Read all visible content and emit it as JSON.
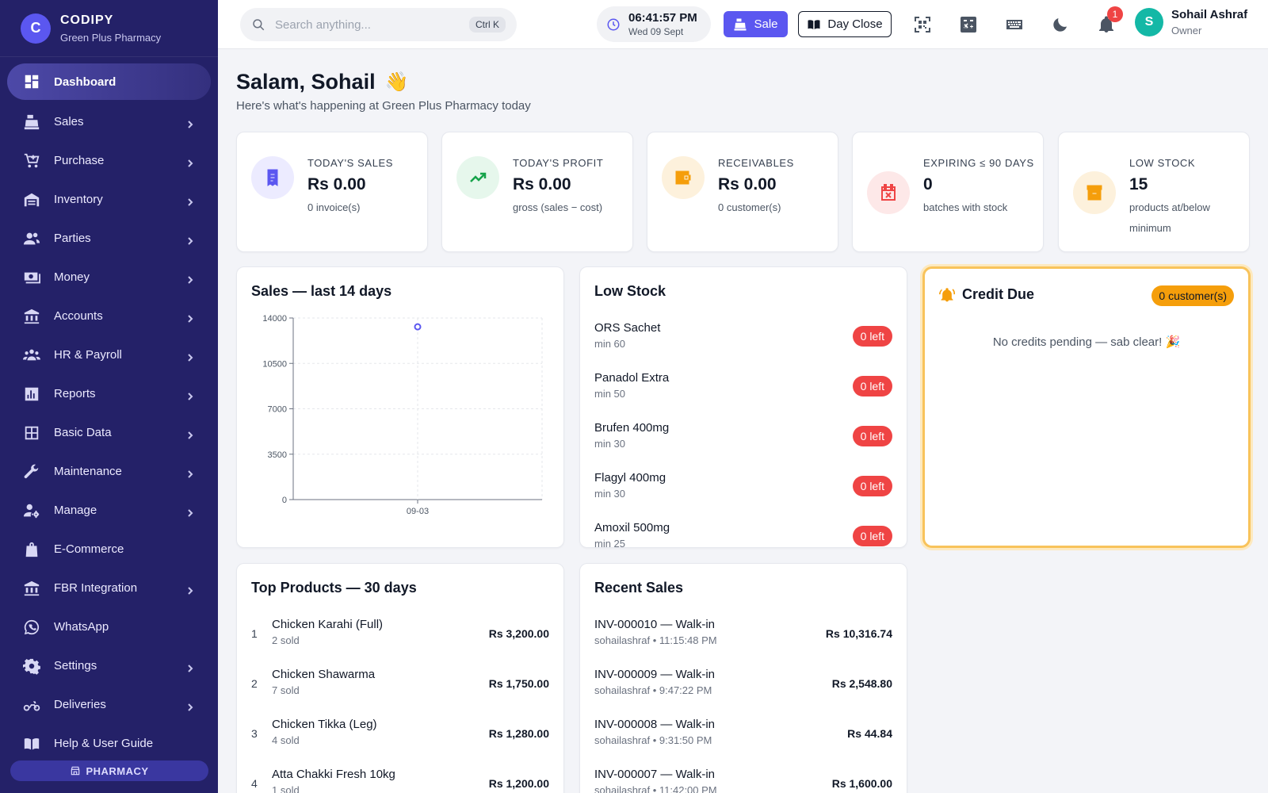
{
  "brand": {
    "logo_letter": "C",
    "name": "CODIPY",
    "subtitle": "Green Plus Pharmacy"
  },
  "sidebar": {
    "items": [
      {
        "label": "Dashboard",
        "icon": "dashboard-icon",
        "active": true,
        "has_chevron": false
      },
      {
        "label": "Sales",
        "icon": "cash-register-icon",
        "has_chevron": true
      },
      {
        "label": "Purchase",
        "icon": "cart-icon",
        "has_chevron": true
      },
      {
        "label": "Inventory",
        "icon": "warehouse-icon",
        "has_chevron": true
      },
      {
        "label": "Parties",
        "icon": "people-icon",
        "has_chevron": true
      },
      {
        "label": "Money",
        "icon": "money-icon",
        "has_chevron": true
      },
      {
        "label": "Accounts",
        "icon": "bank-icon",
        "has_chevron": true
      },
      {
        "label": "HR & Payroll",
        "icon": "team-icon",
        "has_chevron": true
      },
      {
        "label": "Reports",
        "icon": "reports-icon",
        "has_chevron": true
      },
      {
        "label": "Basic Data",
        "icon": "grid-icon",
        "has_chevron": true
      },
      {
        "label": "Maintenance",
        "icon": "wrench-icon",
        "has_chevron": true
      },
      {
        "label": "Manage",
        "icon": "user-gear-icon",
        "has_chevron": true
      },
      {
        "label": "E-Commerce",
        "icon": "shopping-bag-icon",
        "has_chevron": false
      },
      {
        "label": "FBR Integration",
        "icon": "bank-icon",
        "has_chevron": true
      },
      {
        "label": "WhatsApp",
        "icon": "whatsapp-icon",
        "has_chevron": false
      },
      {
        "label": "Settings",
        "icon": "gear-icon",
        "has_chevron": true
      },
      {
        "label": "Deliveries",
        "icon": "motorbike-icon",
        "has_chevron": true
      },
      {
        "label": "Help & User Guide",
        "icon": "book-icon",
        "has_chevron": false
      }
    ],
    "badge": "PHARMACY"
  },
  "header": {
    "search_placeholder": "Search anything...",
    "search_shortcut": "Ctrl K",
    "time": "06:41:57 PM",
    "date": "Wed 09 Sept",
    "sale_label": "Sale",
    "day_close_label": "Day Close",
    "notification_count": "1",
    "user_initial": "S",
    "user_name": "Sohail Ashraf",
    "user_role": "Owner"
  },
  "greeting": {
    "title": "Salam, Sohail",
    "subtitle": "Here's what's happening at Green Plus Pharmacy today"
  },
  "stats": [
    {
      "label": "TODAY'S SALES",
      "value": "Rs 0.00",
      "note": "0 invoice(s)",
      "icon": "receipt-icon",
      "color": "#5b57f0",
      "bg": "#ecebff"
    },
    {
      "label": "TODAY'S PROFIT",
      "value": "Rs 0.00",
      "note": "gross (sales − cost)",
      "icon": "trend-up-icon",
      "color": "#16a34a",
      "bg": "#e6f7ec"
    },
    {
      "label": "RECEIVABLES",
      "value": "Rs 0.00",
      "note": "0 customer(s)",
      "icon": "wallet-icon",
      "color": "#f59e0b",
      "bg": "#fdf1dc"
    },
    {
      "label": "EXPIRING ≤ 90 DAYS",
      "value": "0",
      "note": "batches with stock",
      "icon": "calendar-x-icon",
      "color": "#ef4444",
      "bg": "#fde8e8"
    },
    {
      "label": "LOW STOCK",
      "value": "15",
      "note": "products at/below minimum",
      "icon": "archive-icon",
      "color": "#f59e0b",
      "bg": "#fdf1dc"
    }
  ],
  "sales_chart": {
    "title": "Sales — last 14 days",
    "chart_data": {
      "type": "line",
      "x": [
        "09-03"
      ],
      "y": [
        13320
      ],
      "ylim": [
        0,
        14000
      ],
      "yticks": [
        "14000",
        "10500",
        "7000",
        "3500",
        "0"
      ],
      "grid": true,
      "series_color": "#5b57f0"
    }
  },
  "low_stock": {
    "title": "Low Stock",
    "items": [
      {
        "name": "ORS Sachet",
        "min": "min 60",
        "left": "0 left"
      },
      {
        "name": "Panadol Extra",
        "min": "min 50",
        "left": "0 left"
      },
      {
        "name": "Brufen 400mg",
        "min": "min 30",
        "left": "0 left"
      },
      {
        "name": "Flagyl 400mg",
        "min": "min 30",
        "left": "0 left"
      },
      {
        "name": "Amoxil 500mg",
        "min": "min 25",
        "left": "0 left"
      }
    ]
  },
  "credit_due": {
    "title": "Credit Due",
    "badge": "0 customer(s)",
    "empty": "No credits pending — sab clear! 🎉"
  },
  "top_products": {
    "title": "Top Products — 30 days",
    "items": [
      {
        "rank": "1",
        "name": "Chicken Karahi (Full)",
        "sold": "2 sold",
        "amount": "Rs 3,200.00"
      },
      {
        "rank": "2",
        "name": "Chicken Shawarma",
        "sold": "7 sold",
        "amount": "Rs 1,750.00"
      },
      {
        "rank": "3",
        "name": "Chicken Tikka (Leg)",
        "sold": "4 sold",
        "amount": "Rs 1,280.00"
      },
      {
        "rank": "4",
        "name": "Atta Chakki Fresh 10kg",
        "sold": "1 sold",
        "amount": "Rs 1,200.00"
      }
    ]
  },
  "recent_sales": {
    "title": "Recent Sales",
    "items": [
      {
        "invoice": "INV-000010 — Walk-in",
        "meta": "sohailashraf • 11:15:48 PM",
        "amount": "Rs 10,316.74"
      },
      {
        "invoice": "INV-000009 — Walk-in",
        "meta": "sohailashraf • 9:47:22 PM",
        "amount": "Rs 2,548.80"
      },
      {
        "invoice": "INV-000008 — Walk-in",
        "meta": "sohailashraf • 9:31:50 PM",
        "amount": "Rs 44.84"
      },
      {
        "invoice": "INV-000007 — Walk-in",
        "meta": "sohailashraf • 11:42:00 PM",
        "amount": "Rs 1,600.00"
      }
    ]
  }
}
